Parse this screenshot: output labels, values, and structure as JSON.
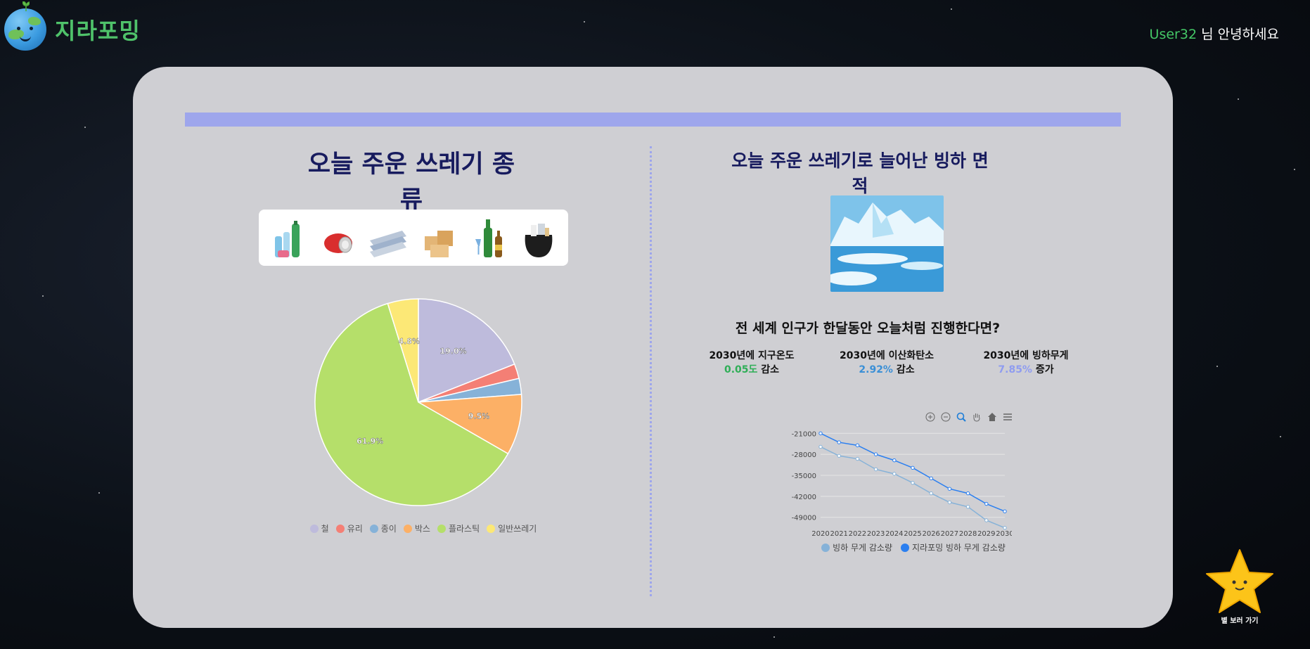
{
  "header": {
    "logo_text": "지라포밍",
    "user_name": "User32",
    "greeting_suffix": " 님 안녕하세요"
  },
  "left": {
    "title": "오늘 주운 쓰레기 종류",
    "trash_icons": [
      "plastic-bottles-icon",
      "can-icon",
      "paper-icon",
      "box-icon",
      "glass-bottles-icon",
      "trash-bag-icon"
    ]
  },
  "right": {
    "title": "오늘 주운 쓰레기로 늘어난 빙하 면적",
    "question": "전 세계 인구가 한달동안 오늘처럼 진행한다면?",
    "stats": [
      {
        "label": "2030년에 지구온도",
        "value": "0.05도",
        "change": " 감소",
        "color": "#2fae57"
      },
      {
        "label": "2030년에 이산화탄소",
        "value": "2.92%",
        "change": " 감소",
        "color": "#3a8fd6"
      },
      {
        "label": "2030년에 빙하무게",
        "value": "7.85%",
        "change": " 증가",
        "color": "#8f9cf0"
      }
    ]
  },
  "star_button": {
    "label": "별 보러 가기"
  },
  "chart_data": [
    {
      "type": "pie",
      "title": "",
      "labels": [
        "철",
        "유리",
        "종이",
        "박스",
        "플라스틱",
        "일반쓰레기"
      ],
      "values": [
        19.0,
        2.3,
        2.5,
        9.5,
        61.9,
        4.8
      ],
      "value_labels": [
        "19.0%",
        "",
        "",
        "9.5%",
        "61.9%",
        "4.8%"
      ],
      "colors": [
        "#bebbdc",
        "#f47f75",
        "#86b2d8",
        "#fcb066",
        "#b5df6a",
        "#fce876"
      ],
      "legend": "bottom"
    },
    {
      "type": "line",
      "title": "",
      "x": [
        2020,
        2021,
        2022,
        2023,
        2024,
        2025,
        2026,
        2027,
        2028,
        2029,
        2030
      ],
      "series": [
        {
          "name": "빙하 무게 감소량",
          "color": "#86b2d8",
          "values": [
            -25500,
            -28500,
            -29500,
            -33000,
            -34500,
            -37500,
            -41000,
            -44000,
            -45500,
            -50000,
            -52500
          ]
        },
        {
          "name": "지라포밍 빙하 무게 감소량",
          "color": "#2b7ff0",
          "values": [
            -21000,
            -24000,
            -25000,
            -28000,
            -30000,
            -32500,
            -36000,
            -39500,
            -41000,
            -44500,
            -47000
          ]
        }
      ],
      "yticks": [
        -21000,
        -28000,
        -35000,
        -42000,
        -49000
      ],
      "ylim": [
        -50000,
        -20000
      ],
      "legend": "bottom",
      "toolbar": [
        "zoom-in-icon",
        "zoom-out-icon",
        "magnify-icon",
        "pan-icon",
        "home-icon",
        "menu-icon"
      ]
    }
  ]
}
